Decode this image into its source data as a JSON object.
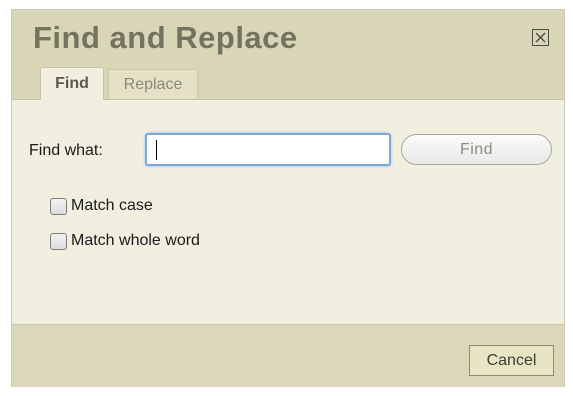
{
  "dialog": {
    "title": "Find and Replace",
    "close_icon": "close-icon"
  },
  "tabs": [
    {
      "label": "Find",
      "active": true
    },
    {
      "label": "Replace",
      "active": false
    }
  ],
  "find": {
    "label": "Find what:",
    "value": "",
    "button_label": "Find"
  },
  "options": [
    {
      "label": "Match case",
      "checked": false
    },
    {
      "label": "Match whole word",
      "checked": false
    }
  ],
  "footer": {
    "cancel_label": "Cancel"
  },
  "colors": {
    "header_bg": "#d9d5b7",
    "body_bg": "#f1efe0",
    "title_text": "#73735f",
    "input_focus_border": "#7ea6d8"
  }
}
